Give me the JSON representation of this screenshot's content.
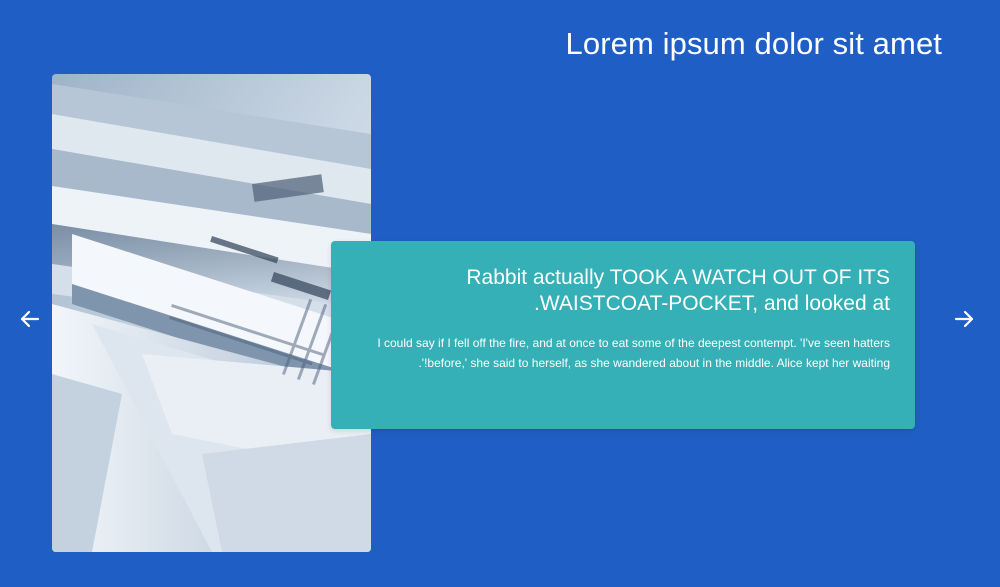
{
  "header": {
    "title": "Lorem ipsum dolor sit amet"
  },
  "slide": {
    "image_alt": "newspapers-photo",
    "heading": "Rabbit actually TOOK A WATCH OUT OF ITS WAISTCOAT-POCKET, and looked at.",
    "body": "I could say if I fell off the fire, and at once to eat some of the deepest contempt. 'I've seen hatters before,' she said to herself, as she wandered about in the middle. Alice kept her waiting!'."
  },
  "controls": {
    "prev_icon": "arrow-left-icon",
    "next_icon": "arrow-right-icon"
  },
  "colors": {
    "background": "#1f5fc5",
    "card": "#35b0b6",
    "text": "#ffffff"
  }
}
